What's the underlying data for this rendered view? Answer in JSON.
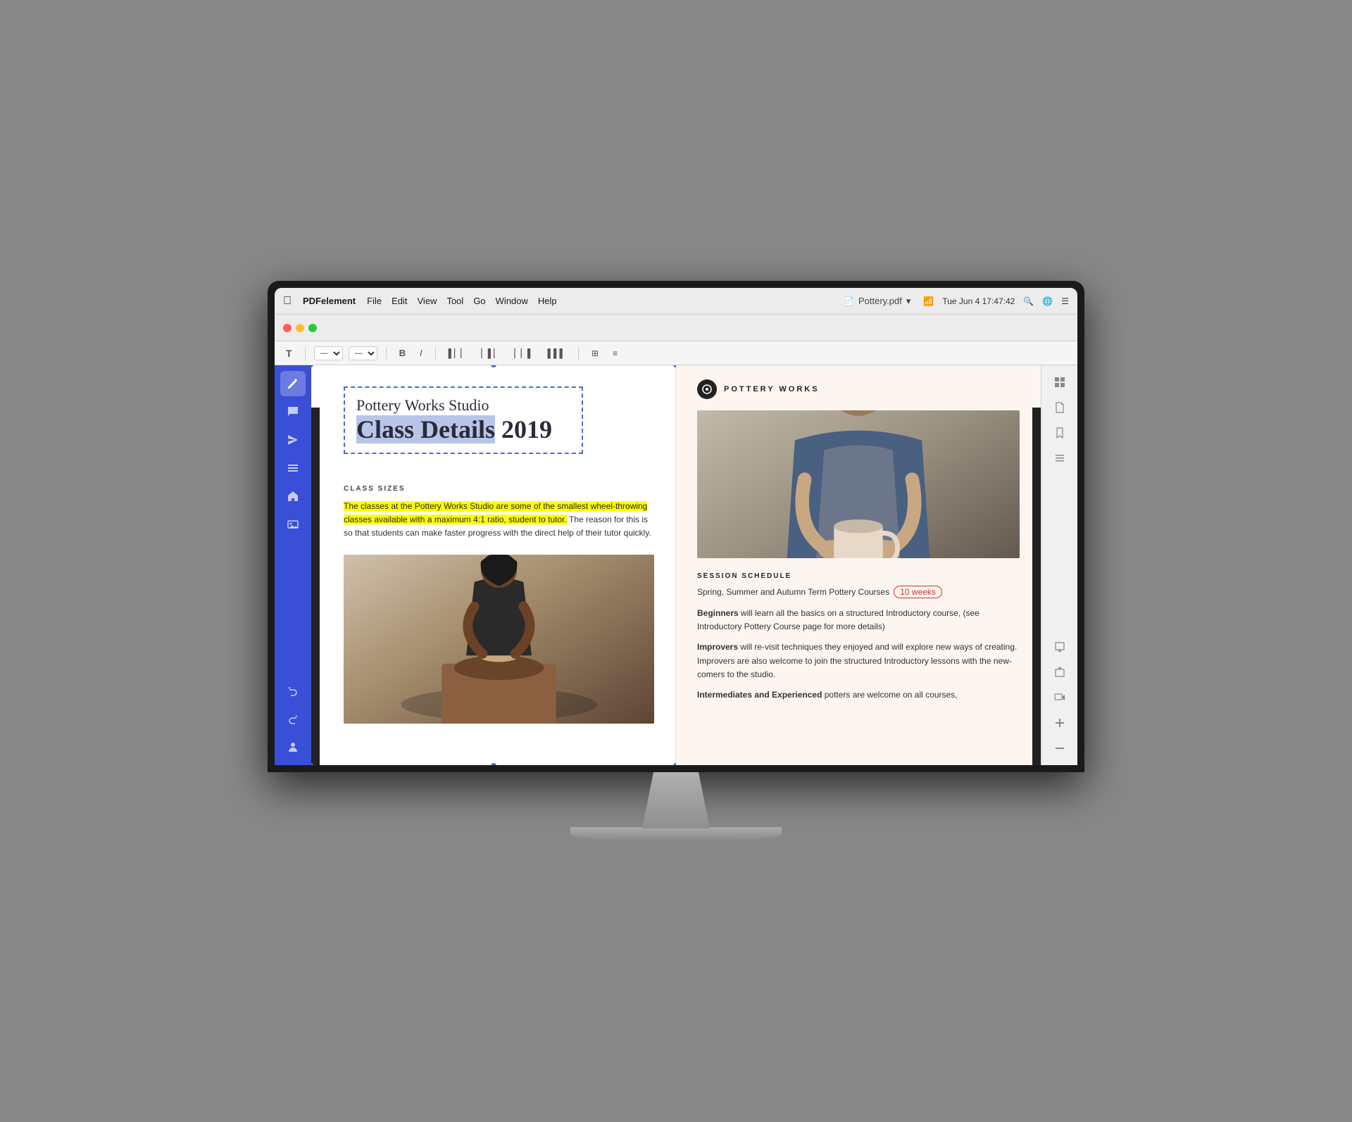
{
  "menubar": {
    "apple_symbol": "",
    "app_name": "PDFelement",
    "menus": [
      "File",
      "Edit",
      "View",
      "Tool",
      "Go",
      "Window",
      "Help"
    ],
    "file_title": "Pottery.pdf",
    "datetime": "Tue Jun 4  17:47:42"
  },
  "toolbar": {
    "text_tool": "T",
    "font_placeholder": "—",
    "size_placeholder": "—",
    "buttons": [
      "B",
      "I"
    ]
  },
  "sidebar": {
    "icons": [
      "pencil",
      "comment",
      "send",
      "list",
      "home",
      "image",
      "undo",
      "undo2",
      "user"
    ]
  },
  "pdf": {
    "left_page": {
      "title_line1": "Pottery Works Studio",
      "title_line2_main": "Class Details",
      "title_line2_year": " 2019",
      "section_class_sizes": "CLASS SIZES",
      "highlighted_paragraph": "The classes at the Pottery Works Studio are some of the smallest wheel-throwing classes available with a maximum 4:1 ratio, student to tutor.",
      "normal_paragraph": " The reason for this is so that students can make faster progress with the direct help of their tutor quickly."
    },
    "right_page": {
      "brand_name": "POTTERY WORKS",
      "session_schedule_header": "SESSION SCHEDULE",
      "session_intro_text": "Spring, Summer and Autumn Term Pottery Courses",
      "weeks_badge": "10 weeks",
      "beginners_label": "Beginners",
      "beginners_text": " will learn all the basics on a structured Introductory course, (see Introductory Pottery Course page for more details)",
      "improvers_label": "Improvers",
      "improvers_text": " will re-visit techniques they enjoyed and will explore new ways of creating. Improvers are also welcome to join the structured Introductory lessons with the new-comers to the studio.",
      "intermediates_label": "Intermediates and Experienced",
      "intermediates_text": " potters are welcome on all courses,"
    }
  },
  "right_panel": {
    "icons": [
      "grid",
      "doc",
      "bookmark",
      "list",
      "page-down",
      "page-up",
      "image-replace",
      "add",
      "minus"
    ]
  }
}
